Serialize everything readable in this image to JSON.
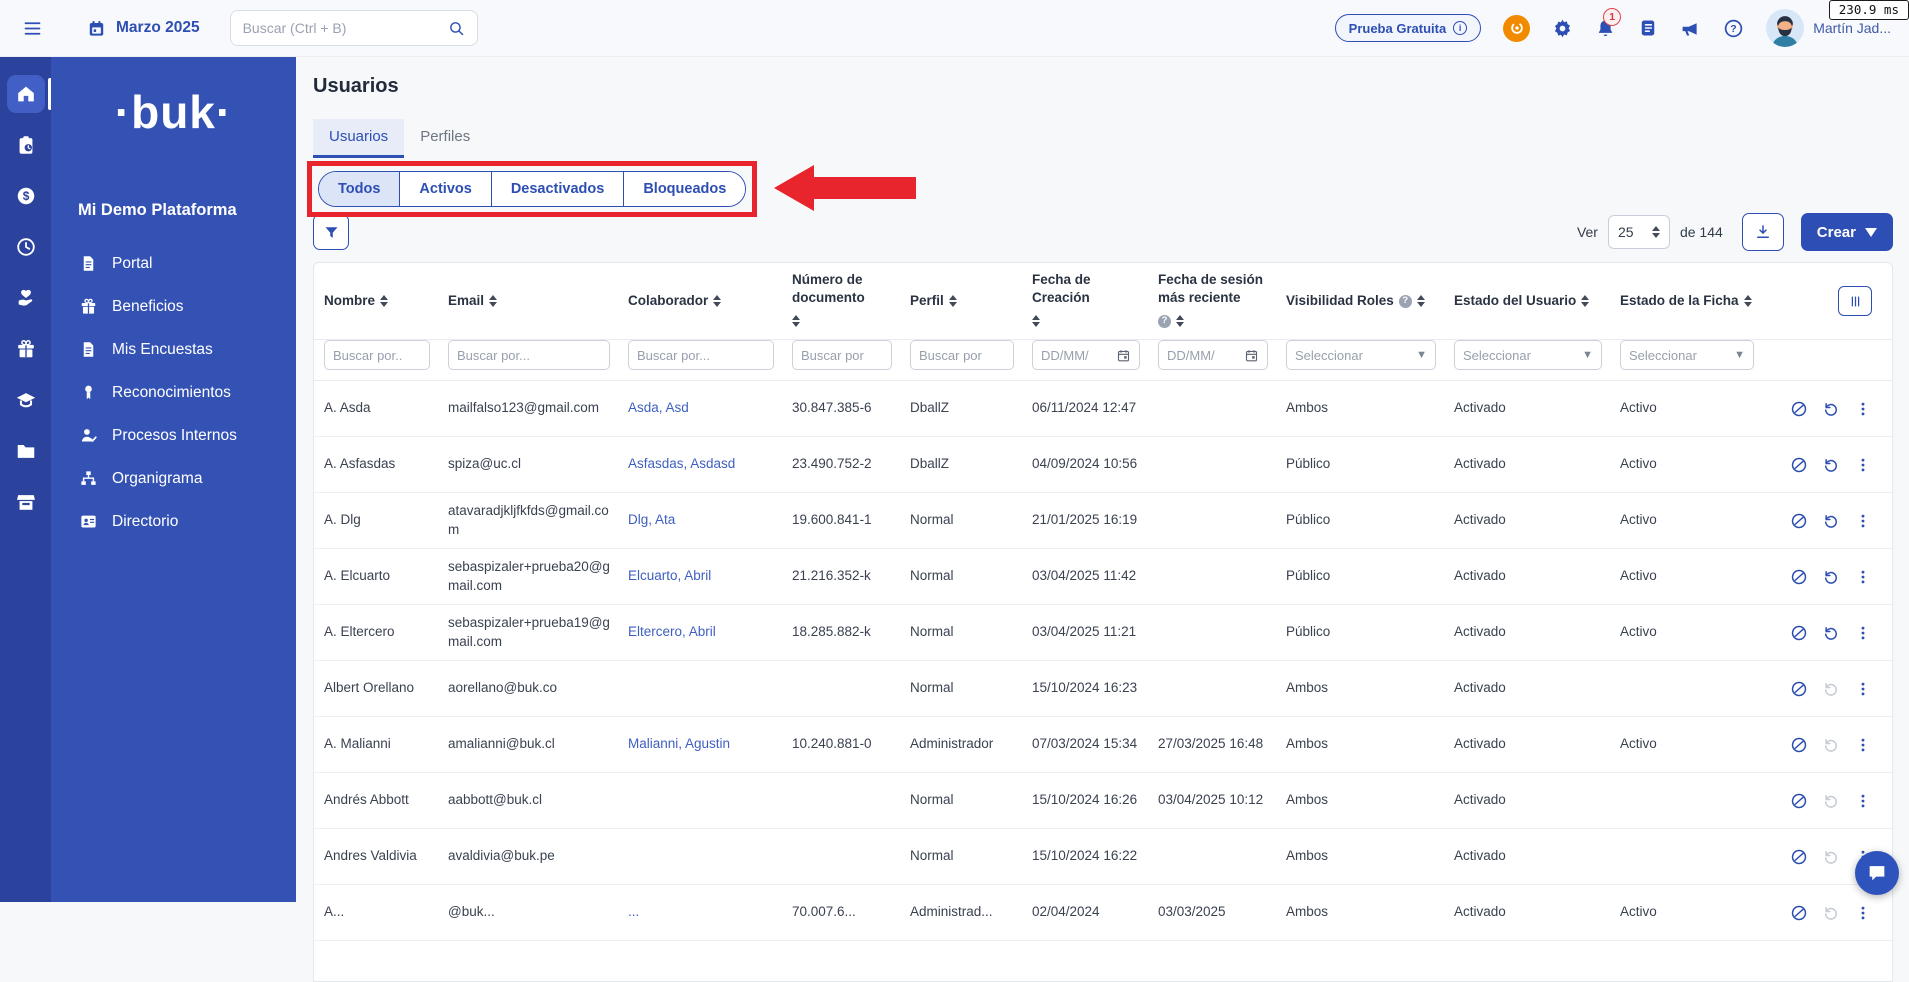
{
  "colors": {
    "brand_blue": "#2d4eb3",
    "sidebar_blue": "#3452b4",
    "rail_blue": "#2b439c",
    "annotation_red": "#e8242c",
    "assistant_orange": "#f28a00",
    "link_blue": "#3f5fc0"
  },
  "topbar": {
    "month_label": "Marzo 2025",
    "search_placeholder": "Buscar (Ctrl + B)",
    "trial_badge": "Prueba Gratuita",
    "notification_count": "1",
    "user_name": "Martín Jad...",
    "perf_chip": "230.9 ms",
    "icons": [
      "hamburger-icon",
      "calendar-icon",
      "search-icon",
      "assistant-icon",
      "gear-icon",
      "bell-icon",
      "changelog-icon",
      "megaphone-icon",
      "help-icon"
    ]
  },
  "sidebar": {
    "logo": "·buk·",
    "company": "Mi Demo Plataforma",
    "rail": [
      {
        "key": "home",
        "icon": "home-icon",
        "active": true
      },
      {
        "key": "tasks",
        "icon": "clipboard-clock-icon",
        "active": false
      },
      {
        "key": "remuneraciones",
        "icon": "dollar-circle-icon",
        "active": false
      },
      {
        "key": "asistencia",
        "icon": "clock-icon",
        "active": false
      },
      {
        "key": "talento",
        "icon": "hand-heart-icon",
        "active": false
      },
      {
        "key": "beneficios",
        "icon": "gift-box-icon",
        "active": false
      },
      {
        "key": "desarrollo",
        "icon": "graduation-cap-icon",
        "active": false
      },
      {
        "key": "documentos",
        "icon": "folder-icon",
        "active": false
      },
      {
        "key": "marketplace",
        "icon": "storefront-icon",
        "active": false
      }
    ],
    "items": [
      {
        "label": "Portal",
        "icon": "file-icon"
      },
      {
        "label": "Beneficios",
        "icon": "gift-box-icon"
      },
      {
        "label": "Mis Encuestas",
        "icon": "file-icon"
      },
      {
        "label": "Reconocimientos",
        "icon": "medal-icon"
      },
      {
        "label": "Procesos Internos",
        "icon": "user-check-icon"
      },
      {
        "label": "Organigrama",
        "icon": "org-chart-icon"
      },
      {
        "label": "Directorio",
        "icon": "contact-card-icon"
      }
    ]
  },
  "page": {
    "title": "Usuarios",
    "tabs": [
      {
        "label": "Usuarios",
        "active": true
      },
      {
        "label": "Perfiles",
        "active": false
      }
    ],
    "segments": [
      {
        "label": "Todos",
        "active": true
      },
      {
        "label": "Activos",
        "active": false
      },
      {
        "label": "Desactivados",
        "active": false
      },
      {
        "label": "Bloqueados",
        "active": false
      }
    ],
    "pager": {
      "ver_label": "Ver",
      "page_size": "25",
      "of_label": "de 144"
    },
    "create_button": "Crear"
  },
  "table": {
    "columns": [
      "Nombre",
      "Email",
      "Colaborador",
      "Número de documento",
      "Perfil",
      "Fecha de Creación",
      "Fecha de sesión más reciente",
      "Visibilidad Roles",
      "Estado del Usuario",
      "Estado de la Ficha"
    ],
    "column_has_info": [
      false,
      false,
      false,
      false,
      false,
      false,
      true,
      true,
      false,
      false
    ],
    "filters": [
      {
        "type": "text",
        "placeholder": "Buscar por.."
      },
      {
        "type": "text",
        "placeholder": "Buscar por..."
      },
      {
        "type": "text",
        "placeholder": "Buscar por..."
      },
      {
        "type": "text",
        "placeholder": "Buscar por"
      },
      {
        "type": "text",
        "placeholder": "Buscar por"
      },
      {
        "type": "date",
        "placeholder": "DD/MM/"
      },
      {
        "type": "date",
        "placeholder": "DD/MM/"
      },
      {
        "type": "select",
        "placeholder": "Seleccionar"
      },
      {
        "type": "select",
        "placeholder": "Seleccionar"
      },
      {
        "type": "select",
        "placeholder": "Seleccionar"
      }
    ],
    "row_action_icons": [
      "block-icon",
      "restore-icon",
      "kebab-icon"
    ],
    "rows": [
      {
        "nombre": "A. Asda",
        "email": "mailfalso123@gmail.com",
        "colaborador": "Asda, Asd",
        "documento": "30.847.385-6",
        "perfil": "DballZ",
        "creacion": "06/11/2024 12:47",
        "sesion": "",
        "visibilidad": "Ambos",
        "estado_usuario": "Activado",
        "estado_ficha": "Activo",
        "restore_enabled": true
      },
      {
        "nombre": "A. Asfasdas",
        "email": "spiza@uc.cl",
        "colaborador": "Asfasdas, Asdasd",
        "documento": "23.490.752-2",
        "perfil": "DballZ",
        "creacion": "04/09/2024 10:56",
        "sesion": "",
        "visibilidad": "Público",
        "estado_usuario": "Activado",
        "estado_ficha": "Activo",
        "restore_enabled": true
      },
      {
        "nombre": "A. Dlg",
        "email": "atavaradjkljfkfds@gmail.com",
        "colaborador": "Dlg, Ata",
        "documento": "19.600.841-1",
        "perfil": "Normal",
        "creacion": "21/01/2025 16:19",
        "sesion": "",
        "visibilidad": "Público",
        "estado_usuario": "Activado",
        "estado_ficha": "Activo",
        "restore_enabled": true
      },
      {
        "nombre": "A. Elcuarto",
        "email": "sebaspizaler+prueba20@gmail.com",
        "colaborador": "Elcuarto, Abril",
        "documento": "21.216.352-k",
        "perfil": "Normal",
        "creacion": "03/04/2025 11:42",
        "sesion": "",
        "visibilidad": "Público",
        "estado_usuario": "Activado",
        "estado_ficha": "Activo",
        "restore_enabled": true
      },
      {
        "nombre": "A. Eltercero",
        "email": "sebaspizaler+prueba19@gmail.com",
        "colaborador": "Eltercero, Abril",
        "documento": "18.285.882-k",
        "perfil": "Normal",
        "creacion": "03/04/2025 11:21",
        "sesion": "",
        "visibilidad": "Público",
        "estado_usuario": "Activado",
        "estado_ficha": "Activo",
        "restore_enabled": true
      },
      {
        "nombre": "Albert Orellano",
        "email": "aorellano@buk.co",
        "colaborador": "",
        "documento": "",
        "perfil": "Normal",
        "creacion": "15/10/2024 16:23",
        "sesion": "",
        "visibilidad": "Ambos",
        "estado_usuario": "Activado",
        "estado_ficha": "",
        "restore_enabled": false
      },
      {
        "nombre": "A. Malianni",
        "email": "amalianni@buk.cl",
        "colaborador": "Malianni, Agustin",
        "documento": "10.240.881-0",
        "perfil": "Administrador",
        "creacion": "07/03/2024 15:34",
        "sesion": "27/03/2025 16:48",
        "visibilidad": "Ambos",
        "estado_usuario": "Activado",
        "estado_ficha": "Activo",
        "restore_enabled": false
      },
      {
        "nombre": "Andrés Abbott",
        "email": "aabbott@buk.cl",
        "colaborador": "",
        "documento": "",
        "perfil": "Normal",
        "creacion": "15/10/2024 16:26",
        "sesion": "03/04/2025 10:12",
        "visibilidad": "Ambos",
        "estado_usuario": "Activado",
        "estado_ficha": "",
        "restore_enabled": false
      },
      {
        "nombre": "Andres Valdivia",
        "email": "avaldivia@buk.pe",
        "colaborador": "",
        "documento": "",
        "perfil": "Normal",
        "creacion": "15/10/2024 16:22",
        "sesion": "",
        "visibilidad": "Ambos",
        "estado_usuario": "Activado",
        "estado_ficha": "",
        "restore_enabled": false
      },
      {
        "nombre": "A...",
        "email": "@buk...",
        "colaborador": "...",
        "documento": "70.007.6...",
        "perfil": "Administrad...",
        "creacion": "02/04/2024",
        "sesion": "03/03/2025",
        "visibilidad": "Ambos",
        "estado_usuario": "Activado",
        "estado_ficha": "Activo",
        "restore_enabled": false
      }
    ]
  }
}
